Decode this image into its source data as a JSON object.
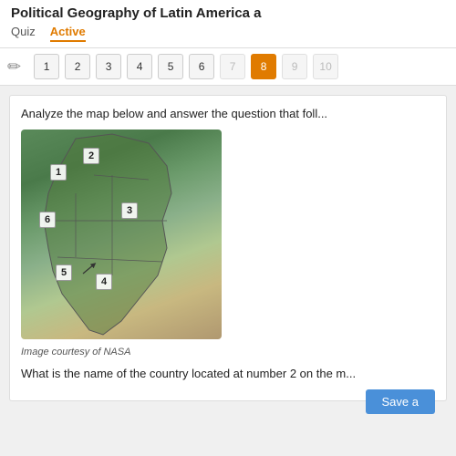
{
  "header": {
    "title": "Political Geography of Latin America a",
    "tab_quiz": "Quiz",
    "tab_active": "Active"
  },
  "toolbar": {
    "pencil_icon": "✏",
    "buttons": [
      {
        "label": "1",
        "state": "normal"
      },
      {
        "label": "2",
        "state": "normal"
      },
      {
        "label": "3",
        "state": "normal"
      },
      {
        "label": "4",
        "state": "normal"
      },
      {
        "label": "5",
        "state": "normal"
      },
      {
        "label": "6",
        "state": "normal"
      },
      {
        "label": "7",
        "state": "dimmed"
      },
      {
        "label": "8",
        "state": "active"
      },
      {
        "label": "9",
        "state": "dimmed"
      },
      {
        "label": "10",
        "state": "dimmed"
      }
    ]
  },
  "content": {
    "question_text": "Analyze the map below and answer the question that foll...",
    "map_labels": [
      "1",
      "2",
      "3",
      "4",
      "5",
      "6"
    ],
    "image_credit": "Image courtesy of NASA",
    "bottom_question": "What is the name of the country located at number 2 on the m...",
    "save_button": "Save a"
  }
}
